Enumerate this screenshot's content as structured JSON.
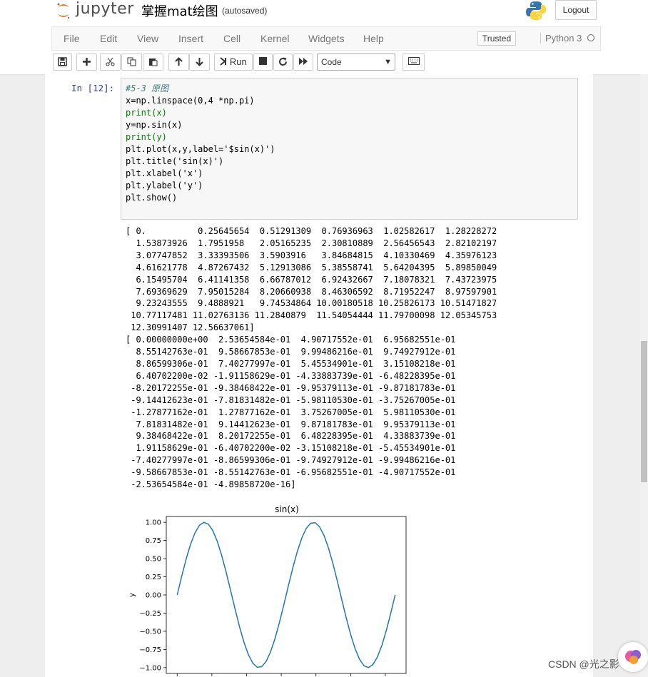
{
  "header": {
    "logo_text": "jupyter",
    "notebook_name": "掌握mat绘图",
    "autosaved": "(autosaved)",
    "logout_label": "Logout"
  },
  "menubar": {
    "items": [
      "File",
      "Edit",
      "View",
      "Insert",
      "Cell",
      "Kernel",
      "Widgets",
      "Help"
    ],
    "trusted_label": "Trusted",
    "kernel_name": "Python 3"
  },
  "toolbar": {
    "run_label": "Run",
    "cell_type": "Code",
    "icons": [
      "save-icon",
      "plus-icon",
      "cut-icon",
      "copy-icon",
      "paste-icon",
      "arrow-up-icon",
      "arrow-down-icon",
      "run-icon",
      "stop-icon",
      "restart-icon",
      "fast-forward-icon",
      "keyboard-icon"
    ]
  },
  "cell": {
    "prompt": "In  [12]:",
    "code_lines": [
      "#5-3 原图",
      "x=np.linspace(0,4 *np.pi)",
      "print(x)",
      "y=np.sin(x)",
      "print(y)",
      "plt.plot(x,y,label='$sin(x)')",
      "plt.title('sin(x)')",
      "plt.xlabel('x')",
      "plt.ylabel('y')",
      "plt.show()"
    ],
    "output_lines": [
      "[ 0.          0.25645654  0.51291309  0.76936963  1.02582617  1.28228272",
      "  1.53873926  1.7951958   2.05165235  2.30810889  2.56456543  2.82102197",
      "  3.07747852  3.33393506  3.5903916   3.84684815  4.10330469  4.35976123",
      "  4.61621778  4.87267432  5.12913086  5.38558741  5.64204395  5.89850049",
      "  6.15495704  6.41141358  6.66787012  6.92432667  7.18078321  7.43723975",
      "  7.69369629  7.95015284  8.20660938  8.46306592  8.71952247  8.97597901",
      "  9.23243555  9.4888921   9.74534864 10.00180518 10.25826173 10.51471827",
      " 10.77117481 11.02763136 11.2840879  11.54054444 11.79700098 12.05345753",
      " 12.30991407 12.56637061]",
      "[ 0.00000000e+00  2.53654584e-01  4.90717552e-01  6.95682551e-01",
      "  8.55142763e-01  9.58667853e-01  9.99486216e-01  9.74927912e-01",
      "  8.86599306e-01  7.40277997e-01  5.45534901e-01  3.15108218e-01",
      "  6.40702200e-02 -1.91158629e-01 -4.33883739e-01 -6.48228395e-01",
      " -8.20172255e-01 -9.38468422e-01 -9.95379113e-01 -9.87181783e-01",
      " -9.14412623e-01 -7.81831482e-01 -5.98110530e-01 -3.75267005e-01",
      " -1.27877162e-01  1.27877162e-01  3.75267005e-01  5.98110530e-01",
      "  7.81831482e-01  9.14412623e-01  9.87181783e-01  9.95379113e-01",
      "  9.38468422e-01  8.20172255e-01  6.48228395e-01  4.33883739e-01",
      "  1.91158629e-01 -6.40702200e-02 -3.15108218e-01 -5.45534901e-01",
      " -7.40277997e-01 -8.86599306e-01 -9.74927912e-01 -9.99486216e-01",
      " -9.58667853e-01 -8.55142763e-01 -6.95682551e-01 -4.90717552e-01",
      " -2.53654584e-01 -4.89858720e-16]"
    ]
  },
  "chart_data": {
    "type": "line",
    "title": "sin(x)",
    "xlabel": "",
    "ylabel": "y",
    "ylim": [
      -1.0,
      1.0
    ],
    "yticks": [
      "1.00",
      "0.75",
      "0.50",
      "0.25",
      "0.00",
      "−0.25",
      "−0.50",
      "−0.75",
      "−1.00"
    ],
    "ytick_values": [
      1.0,
      0.75,
      0.5,
      0.25,
      0.0,
      -0.25,
      -0.5,
      -0.75,
      -1.0
    ],
    "line_color": "#1f77b4",
    "series": [
      {
        "x": [
          0.0,
          0.25645654,
          0.51291309,
          0.76936963,
          1.02582617,
          1.28228272,
          1.53873926,
          1.7951958,
          2.05165235,
          2.30810889,
          2.56456543,
          2.82102197,
          3.07747852,
          3.33393506,
          3.5903916,
          3.84684815,
          4.10330469,
          4.35976123,
          4.61621778,
          4.87267432,
          5.12913086,
          5.38558741,
          5.64204395,
          5.89850049,
          6.15495704,
          6.41141358,
          6.66787012,
          6.92432667,
          7.18078321,
          7.43723975,
          7.69369629,
          7.95015284,
          8.20660938,
          8.46306592,
          8.71952247,
          8.97597901,
          9.23243555,
          9.4888921,
          9.74534864,
          10.00180518,
          10.25826173,
          10.51471827,
          10.77117481,
          11.02763136,
          11.2840879,
          11.54054444,
          11.79700098,
          12.05345753,
          12.30991407,
          12.56637061
        ],
        "values": [
          0.0,
          0.253654584,
          0.490717552,
          0.695682551,
          0.855142763,
          0.958667853,
          0.999486216,
          0.974927912,
          0.886599306,
          0.740277997,
          0.545534901,
          0.315108218,
          0.06407022,
          -0.191158629,
          -0.433883739,
          -0.648228395,
          -0.820172255,
          -0.938468422,
          -0.995379113,
          -0.987181783,
          -0.914412623,
          -0.781831482,
          -0.59811053,
          -0.375267005,
          -0.127877162,
          0.127877162,
          0.375267005,
          0.59811053,
          0.781831482,
          0.914412623,
          0.987181783,
          0.995379113,
          0.938468422,
          0.820172255,
          0.648228395,
          0.433883739,
          0.191158629,
          -0.06407022,
          -0.315108218,
          -0.545534901,
          -0.740277997,
          -0.886599306,
          -0.974927912,
          -0.999486216,
          -0.958667853,
          -0.855142763,
          -0.695682551,
          -0.490717552,
          -0.253654584,
          0.0
        ]
      }
    ]
  },
  "watermark": "CSDN @光之影"
}
